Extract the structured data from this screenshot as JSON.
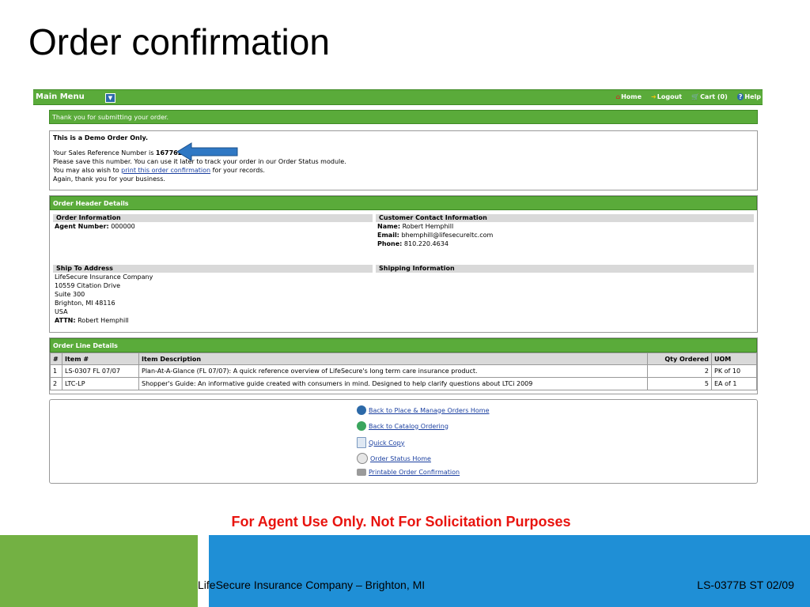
{
  "slide": {
    "title": "Order confirmation",
    "disclaimer": "For Agent Use Only. Not For Solicitation Purposes",
    "footer_left": "LifeSecure Insurance Company – Brighton, MI",
    "footer_right": "LS-0377B ST 02/09"
  },
  "menubar": {
    "main_menu_label": "Main Menu",
    "dropdown_icon": "chevron-down-icon",
    "links": [
      {
        "label": "Home",
        "icon": "home-icon"
      },
      {
        "label": "Logout",
        "icon": "logout-icon"
      },
      {
        "label": "Cart (0)",
        "icon": "cart-icon"
      },
      {
        "label": "Help",
        "icon": "help-icon"
      }
    ]
  },
  "confirmation": {
    "thank_you": "Thank you for submitting your order.",
    "demo_notice": "This is a Demo Order Only.",
    "ref_prefix": "Your Sales Reference Number is ",
    "ref_number": "16776266",
    "ref_suffix": ".",
    "save_line": "Please save this number. You can use it later to track your order in our Order Status module.",
    "print_prefix": "You may also wish to ",
    "print_link": "print this order confirmation",
    "print_suffix": " for your records.",
    "thanks_again": "Again, thank you for your business."
  },
  "order_header": {
    "title": "Order Header Details",
    "order_info_title": "Order Information",
    "agent_label": "Agent Number:",
    "agent_value": "000000",
    "contact_title": "Customer Contact Information",
    "name_label": "Name:",
    "name_value": "Robert Hemphill",
    "email_label": "Email:",
    "email_value": "bhemphill@lifesecureltc.com",
    "phone_label": "Phone:",
    "phone_value": "810.220.4634",
    "ship_to_title": "Ship To Address",
    "ship_to_lines": [
      "LifeSecure Insurance Company",
      "10559 Citation Drive",
      "Suite 300",
      "Brighton, MI 48116",
      "USA"
    ],
    "attn_label": "ATTN:",
    "attn_value": "Robert Hemphill",
    "shipping_info_title": "Shipping Information"
  },
  "order_lines": {
    "title": "Order Line Details",
    "columns": [
      "#",
      "Item #",
      "Item Description",
      "Qty Ordered",
      "UOM"
    ],
    "rows": [
      {
        "n": "1",
        "item": "LS-0307 FL 07/07",
        "desc": "Plan-At-A-Glance (FL 07/07): A quick reference overview of LifeSecure's long term care insurance product.",
        "qty": "2",
        "uom": "PK of 10"
      },
      {
        "n": "2",
        "item": "LTC-LP",
        "desc": "Shopper's Guide: An informative guide created with consumers in mind. Designed to help clarify questions about LTCi 2009",
        "qty": "5",
        "uom": "EA of 1"
      }
    ]
  },
  "actions": [
    {
      "label": "Back to Place & Manage Orders Home",
      "icon": "back-icon"
    },
    {
      "label": "Back to Catalog Ordering",
      "icon": "catalog-icon"
    },
    {
      "label": "Quick Copy",
      "icon": "copy-icon"
    },
    {
      "label": "Order Status Home",
      "icon": "status-icon"
    },
    {
      "label": "Printable Order Confirmation",
      "icon": "printer-icon"
    }
  ],
  "colors": {
    "accent_green": "#5aab3a",
    "disclaimer_red": "#e8140f",
    "footer_blue": "#1f8fd6",
    "footer_green": "#73b143"
  }
}
